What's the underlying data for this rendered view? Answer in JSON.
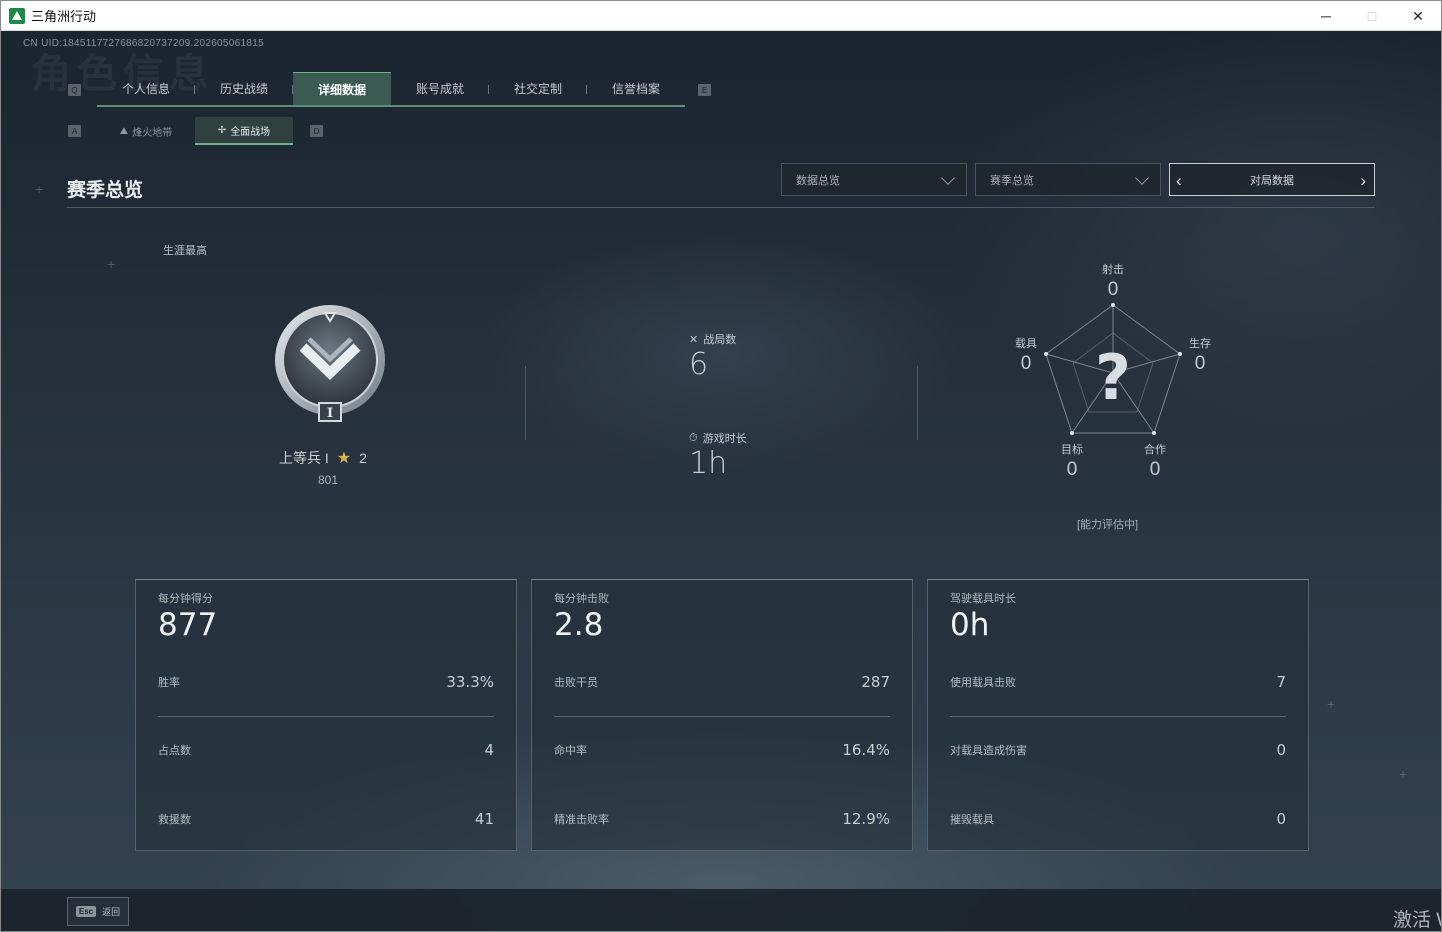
{
  "window": {
    "title": "三角洲行动",
    "minimize": "─",
    "maximize": "□",
    "close": "✕"
  },
  "uid": "CN UID:1845117727686820737209.202605061815",
  "ghost_title": "角色信息",
  "tabs": {
    "left_key": "Q",
    "right_key": "E",
    "items": [
      {
        "label": "个人信息",
        "active": false
      },
      {
        "label": "历史战绩",
        "active": false
      },
      {
        "label": "详细数据",
        "active": true
      },
      {
        "label": "账号成就",
        "active": false
      },
      {
        "label": "社交定制",
        "active": false
      },
      {
        "label": "信誉档案",
        "active": false
      }
    ]
  },
  "subtabs": {
    "left_key": "A",
    "right_key": "D",
    "items": [
      {
        "label": "烽火地带",
        "active": false
      },
      {
        "label": "全面战场",
        "active": true
      }
    ]
  },
  "section": {
    "title": "赛季总览"
  },
  "filters": {
    "data_overview": "数据总览",
    "season_overview": "赛季总览",
    "pager_label": "对局数据",
    "prev": "‹",
    "next": "›"
  },
  "rank": {
    "caption": "生涯最高",
    "name": "上等兵 I",
    "stars": "2",
    "points": "801",
    "tier_roman": "I"
  },
  "summary": {
    "matches_label": "战局数",
    "matches_value": "6",
    "playtime_label": "游戏时长",
    "playtime_value": "1h"
  },
  "radar": {
    "center": "?",
    "axes": [
      {
        "label": "射击",
        "value": "0"
      },
      {
        "label": "生存",
        "value": "0"
      },
      {
        "label": "合作",
        "value": "0"
      },
      {
        "label": "目标",
        "value": "0"
      },
      {
        "label": "载具",
        "value": "0"
      }
    ],
    "ability_note": "[能力评估中]"
  },
  "cards": [
    {
      "title": "每分钟得分",
      "big": "877",
      "rows": [
        {
          "k": "胜率",
          "v": "33.3%"
        },
        {
          "k": "占点数",
          "v": "4"
        },
        {
          "k": "救援数",
          "v": "41"
        }
      ]
    },
    {
      "title": "每分钟击败",
      "big": "2.8",
      "rows": [
        {
          "k": "击败干员",
          "v": "287"
        },
        {
          "k": "命中率",
          "v": "16.4%"
        },
        {
          "k": "精准击败率",
          "v": "12.9%"
        }
      ]
    },
    {
      "title": "驾驶载具时长",
      "big": "0h",
      "rows": [
        {
          "k": "使用载具击败",
          "v": "7"
        },
        {
          "k": "对载具造成伤害",
          "v": "0"
        },
        {
          "k": "摧毁载具",
          "v": "0"
        }
      ]
    }
  ],
  "footer": {
    "esc_key": "Esc",
    "back_label": "返回",
    "watermark": "激活 W"
  }
}
